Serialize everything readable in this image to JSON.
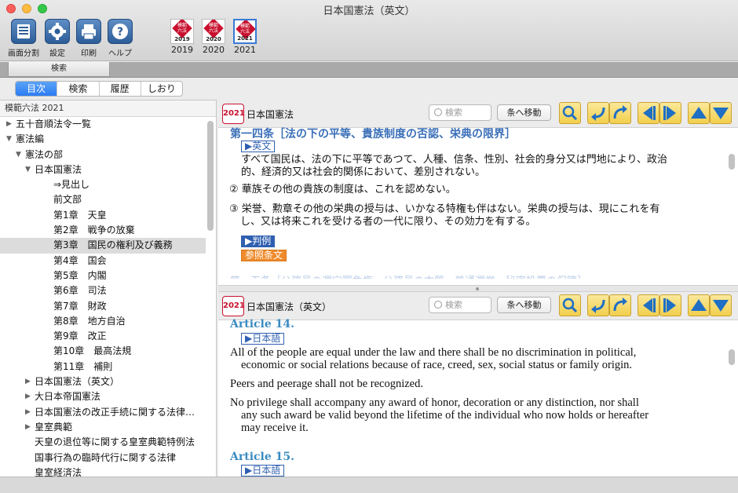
{
  "window": {
    "title": "日本国憲法（英文）"
  },
  "toolbar": {
    "buttons": [
      {
        "label": "画面分割",
        "icon": "split-screen-icon"
      },
      {
        "label": "設定",
        "icon": "gear-icon"
      },
      {
        "label": "印刷",
        "icon": "printer-icon"
      },
      {
        "label": "ヘルプ",
        "icon": "help-icon"
      }
    ],
    "editions": [
      {
        "year": "2019",
        "book_text": "模範\n六法",
        "book_year": "2019"
      },
      {
        "year": "2020",
        "book_text": "模範\n六法",
        "book_year": "2020"
      },
      {
        "year": "2021",
        "book_text": "模範\n六法",
        "book_year": "2021",
        "selected": true
      }
    ]
  },
  "search_strip": {
    "tab_label": "検索"
  },
  "segments": [
    "目次",
    "検索",
    "履歴",
    "しおり"
  ],
  "sidebar": {
    "header": "模範六法 2021",
    "tree": [
      {
        "label": "五十音順法令一覧",
        "level": 0,
        "arrow": "▶"
      },
      {
        "label": "憲法編",
        "level": 0,
        "arrow": "▼"
      },
      {
        "label": "憲法の部",
        "level": 1,
        "arrow": "▼"
      },
      {
        "label": "日本国憲法",
        "level": 2,
        "arrow": "▼"
      },
      {
        "label": "⇒見出し",
        "level": 3,
        "arrow": ""
      },
      {
        "label": "前文部",
        "level": 3,
        "arrow": ""
      },
      {
        "label": "第1章　天皇",
        "level": 3,
        "arrow": ""
      },
      {
        "label": "第2章　戦争の放棄",
        "level": 3,
        "arrow": ""
      },
      {
        "label": "第3章　国民の権利及び義務",
        "level": 3,
        "arrow": "",
        "selected": true
      },
      {
        "label": "第4章　国会",
        "level": 3,
        "arrow": ""
      },
      {
        "label": "第5章　内閣",
        "level": 3,
        "arrow": ""
      },
      {
        "label": "第6章　司法",
        "level": 3,
        "arrow": ""
      },
      {
        "label": "第7章　財政",
        "level": 3,
        "arrow": ""
      },
      {
        "label": "第8章　地方自治",
        "level": 3,
        "arrow": ""
      },
      {
        "label": "第9章　改正",
        "level": 3,
        "arrow": ""
      },
      {
        "label": "第10章　最高法規",
        "level": 3,
        "arrow": ""
      },
      {
        "label": "第11章　補則",
        "level": 3,
        "arrow": ""
      },
      {
        "label": "日本国憲法（英文）",
        "level": 2,
        "arrow": "▶"
      },
      {
        "label": "大日本帝国憲法",
        "level": 2,
        "arrow": "▶"
      },
      {
        "label": "日本国憲法の改正手続に関する法律…",
        "level": 2,
        "arrow": "▶"
      },
      {
        "label": "皇室典範",
        "level": 2,
        "arrow": "▶"
      },
      {
        "label": "天皇の退位等に関する皇室典範特例法",
        "level": 2,
        "arrow": ""
      },
      {
        "label": "国事行為の臨時代行に関する法律",
        "level": 2,
        "arrow": ""
      },
      {
        "label": "皇室経済法",
        "level": 2,
        "arrow": ""
      }
    ]
  },
  "pane_top": {
    "badge": "2021",
    "title": "日本国憲法",
    "search_placeholder": "検索",
    "jump_label": "条へ移動",
    "article_title": "第一四条［法の下の平等、貴族制度の否認、栄典の限界］",
    "english_link": "▶英文",
    "para1_line1": "すべて国民は、法の下に平等であつて、人種、信条、性別、社会的身分又は門地により、政治",
    "para1_line2": "的、経済的又は社会的関係において、差別されない。",
    "para2_num": "②",
    "para2": "華族その他の貴族の制度は、これを認めない。",
    "para3_num": "③",
    "para3_line1": "栄誉、勲章その他の栄典の授与は、いかなる特権も伴はない。栄典の授与は、現にこれを有",
    "para3_line2": "し、又は将来これを受ける者の一代に限り、その効力を有する。",
    "precedent_link": "▶判例",
    "reference_link": "参照条文",
    "next_fade": "第一五条［公務員の選定罷免権、公務員の本質、普通選挙・秘密投票の保障］"
  },
  "pane_bottom": {
    "badge": "2021",
    "title": "日本国憲法（英文）",
    "search_placeholder": "検索",
    "jump_label": "条へ移動",
    "article14_title": "Article 14.",
    "japanese_link": "▶日本語",
    "p1_line1": "All of the people are equal under the law and there shall be no discrimination in political,",
    "p1_line2": "economic or social relations because of race, creed, sex, social status or family origin.",
    "p2": "Peers and peerage shall not be recognized.",
    "p3_line1": "No privilege shall accompany any award of honor, decoration or any distinction, nor shall",
    "p3_line2": "any such award be valid beyond the lifetime of the individual who now holds or hereafter",
    "p3_line3": "may receive it.",
    "article15_title": "Article 15.",
    "japanese_link2": "▶日本語"
  },
  "colors": {
    "accent_blue": "#2c7cf2",
    "nav_yellow": "#f2cf4d",
    "nav_blue": "#1f6fc4",
    "article_jp": "#3a6fb8",
    "article_en": "#3a8bc0",
    "brand_red": "#c8102e",
    "reference_orange": "#ef8b2c"
  }
}
